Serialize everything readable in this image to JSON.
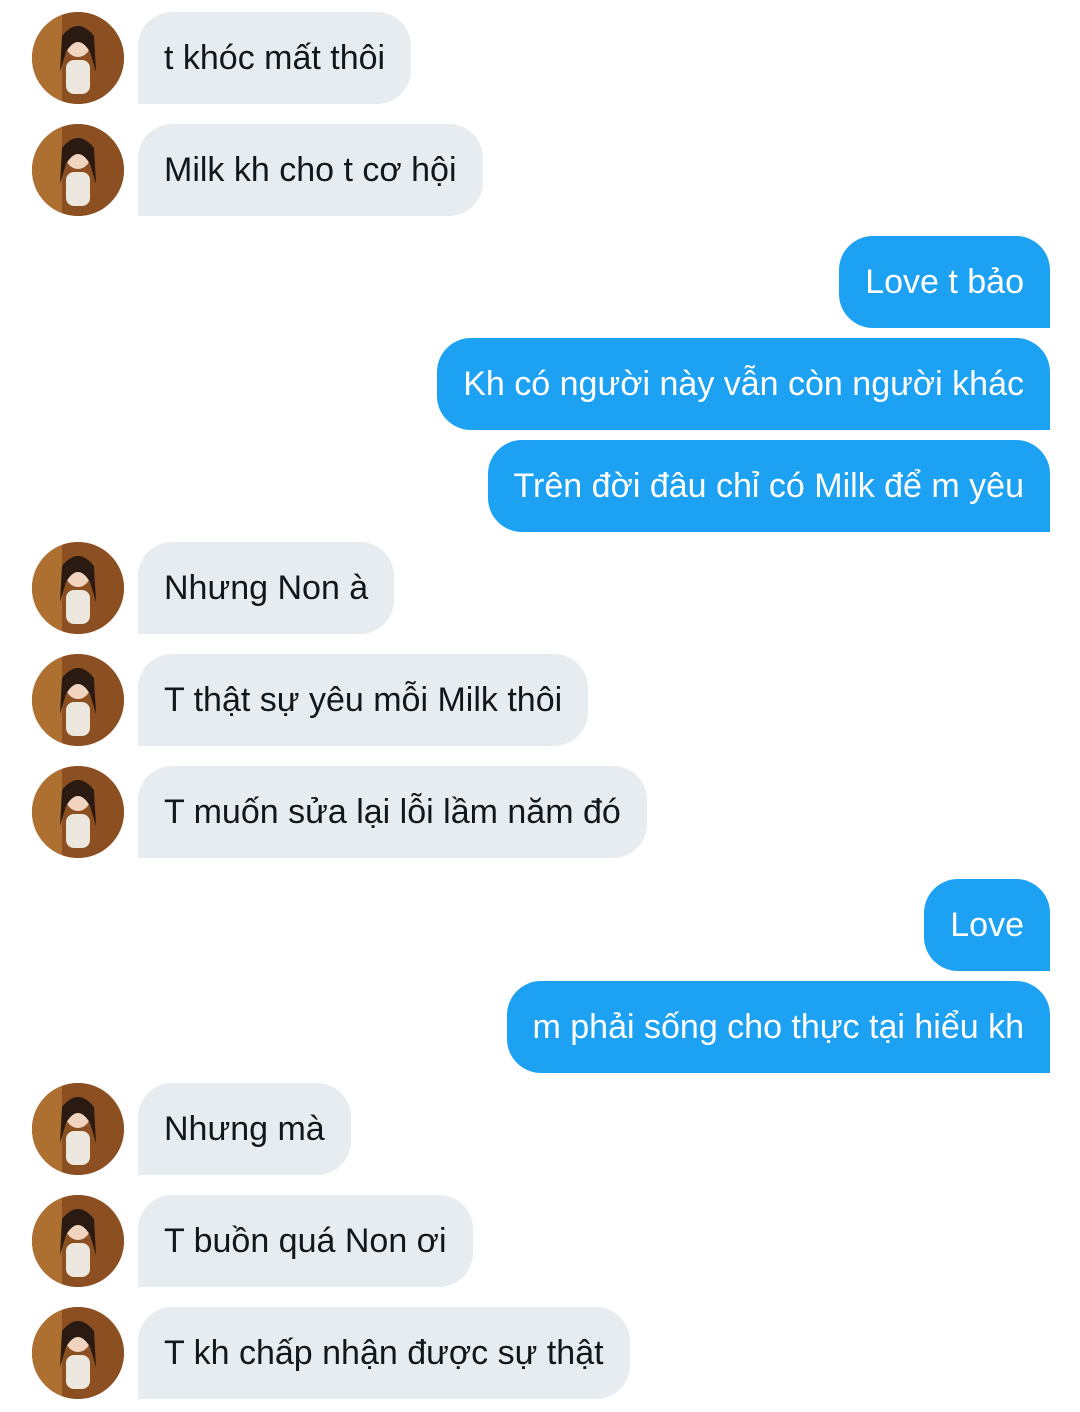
{
  "conversation": {
    "messages": [
      {
        "side": "in",
        "text": "t khóc mất thôi"
      },
      {
        "side": "in",
        "text": "Milk kh cho t cơ hội"
      },
      {
        "side": "out",
        "text": "Love t bảo"
      },
      {
        "side": "out",
        "text": "Kh có người này vẫn còn người khác"
      },
      {
        "side": "out",
        "text": "Trên đời đâu chỉ có Milk để m yêu"
      },
      {
        "side": "in",
        "text": "Nhưng Non à"
      },
      {
        "side": "in",
        "text": "T thật sự yêu mỗi Milk thôi"
      },
      {
        "side": "in",
        "text": "T muốn sửa lại lỗi lầm năm đó"
      },
      {
        "side": "out",
        "text": "Love"
      },
      {
        "side": "out",
        "text": "m phải sống cho thực tại hiểu kh"
      },
      {
        "side": "in",
        "text": "Nhưng mà"
      },
      {
        "side": "in",
        "text": "T buồn quá Non ơi"
      },
      {
        "side": "in",
        "text": "T kh chấp nhận được sự thật"
      }
    ]
  },
  "colors": {
    "incoming_bubble": "#e6ecf0",
    "outgoing_bubble": "#1da1f2",
    "incoming_text": "#14171a",
    "outgoing_text": "#ffffff"
  }
}
